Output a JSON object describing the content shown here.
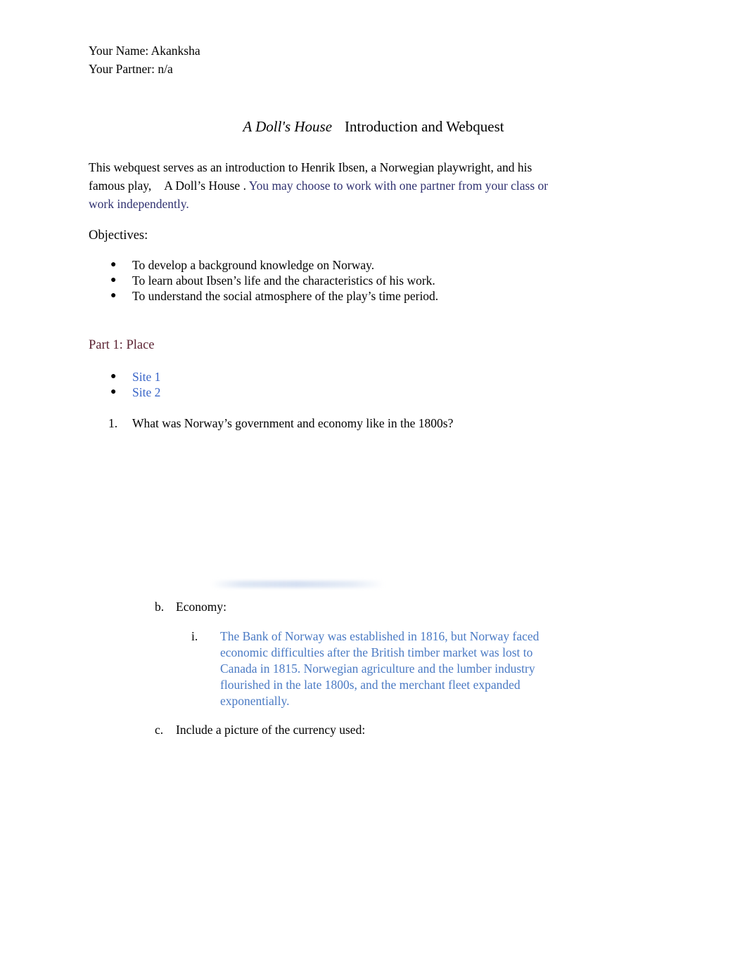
{
  "document": {
    "header": {
      "name_line": "Your Name: Akanksha",
      "partner_line": "Your Partner: n/a"
    },
    "title": {
      "play_title": "A Doll's House",
      "rest": "Introduction and Webquest"
    },
    "intro": {
      "text_part1": "This webquest serves as an introduction to Henrik Ibsen, a Norwegian playwright, and his famous play,",
      "play_title": "A Doll’s House",
      "period": ".",
      "note": "You may choose to work with one partner from your class or work independently."
    },
    "objectives": {
      "heading": "Objectives:",
      "items": [
        "To develop a background knowledge on Norway.",
        "To learn about Ibsen’s life and the characteristics of his work.",
        "To understand the social atmosphere of the play’s time period."
      ]
    },
    "part1": {
      "heading": "Part 1: Place",
      "links": [
        "Site 1",
        "Site 2"
      ],
      "questions": [
        {
          "marker": "1.",
          "text": "What was Norway’s government and economy like in the 1800s?"
        }
      ],
      "subitems": {
        "b": {
          "marker": "b.",
          "label": "Economy:",
          "answer_marker": "i.",
          "answer": "The Bank of Norway was established in 1816, but Norway faced economic difficulties after the British timber market was lost to Canada in 1815. Norwegian agriculture and the lumber industry flourished in the late 1800s, and the merchant fleet expanded exponentially."
        },
        "c": {
          "marker": "c.",
          "label": "Include a picture of the currency used:"
        }
      }
    },
    "bullet_glyph": "●",
    "colors": {
      "body_text": "#000000",
      "note_blue": "#2f3170",
      "heading_maroon": "#5c2434",
      "link_blue": "#3a66c8",
      "answer_blue": "#4a7ac4",
      "page_background": "#ffffff"
    }
  }
}
